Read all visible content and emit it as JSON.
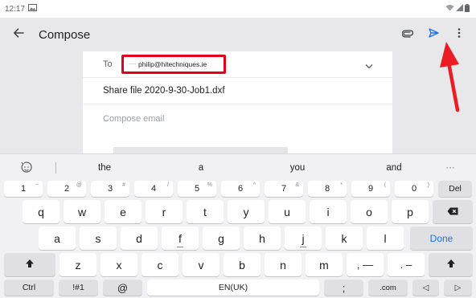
{
  "status_bar": {
    "time": "12:17"
  },
  "app_bar": {
    "title": "Compose"
  },
  "compose": {
    "to_label": "To",
    "to_prefix": "——",
    "to_value": "philip@hitechniques.ie",
    "subject": "Share file 2020-9-30-Job1.dxf",
    "body_placeholder": "Compose email"
  },
  "keyboard": {
    "suggestions": [
      "the",
      "a",
      "you",
      "and",
      "···"
    ],
    "number_row": [
      {
        "main": "1",
        "alt": "~"
      },
      {
        "main": "2",
        "alt": "@"
      },
      {
        "main": "3",
        "alt": "#"
      },
      {
        "main": "4",
        "alt": "/"
      },
      {
        "main": "5",
        "alt": "%"
      },
      {
        "main": "6",
        "alt": "^"
      },
      {
        "main": "7",
        "alt": "&"
      },
      {
        "main": "8",
        "alt": "*"
      },
      {
        "main": "9",
        "alt": "("
      },
      {
        "main": "0",
        "alt": ")"
      }
    ],
    "del_label": "Del",
    "row1": [
      "q",
      "w",
      "e",
      "r",
      "t",
      "y",
      "u",
      "i",
      "o",
      "p"
    ],
    "row2": [
      "a",
      "s",
      "d",
      "f",
      "g",
      "h",
      "j",
      "k",
      "l"
    ],
    "done_label": "Done",
    "row3": [
      "z",
      "x",
      "c",
      "v",
      "b",
      "n",
      "m"
    ],
    "comma_key": ", —",
    "period_key": ". –",
    "ctrl_label": "Ctrl",
    "sym_label": "!#1",
    "at_label": "@",
    "space_label": "EN(UK)",
    "semicolon_label": ";",
    "dotcom_label": ".com",
    "left_arrow": "◁",
    "right_arrow": "▷"
  },
  "colors": {
    "accent": "#1a73e8",
    "highlight_box": "#e3001b",
    "annotation_arrow": "#ec1c24"
  },
  "icons": {
    "status_left": "image-icon",
    "status_right": [
      "wifi-icon",
      "signal-icon",
      "battery-icon"
    ],
    "app_bar": [
      "back-arrow-icon",
      "attachment-icon",
      "send-icon",
      "more-vert-icon"
    ],
    "keyboard": [
      "emoji-icon",
      "backspace-icon",
      "shift-icon"
    ]
  }
}
